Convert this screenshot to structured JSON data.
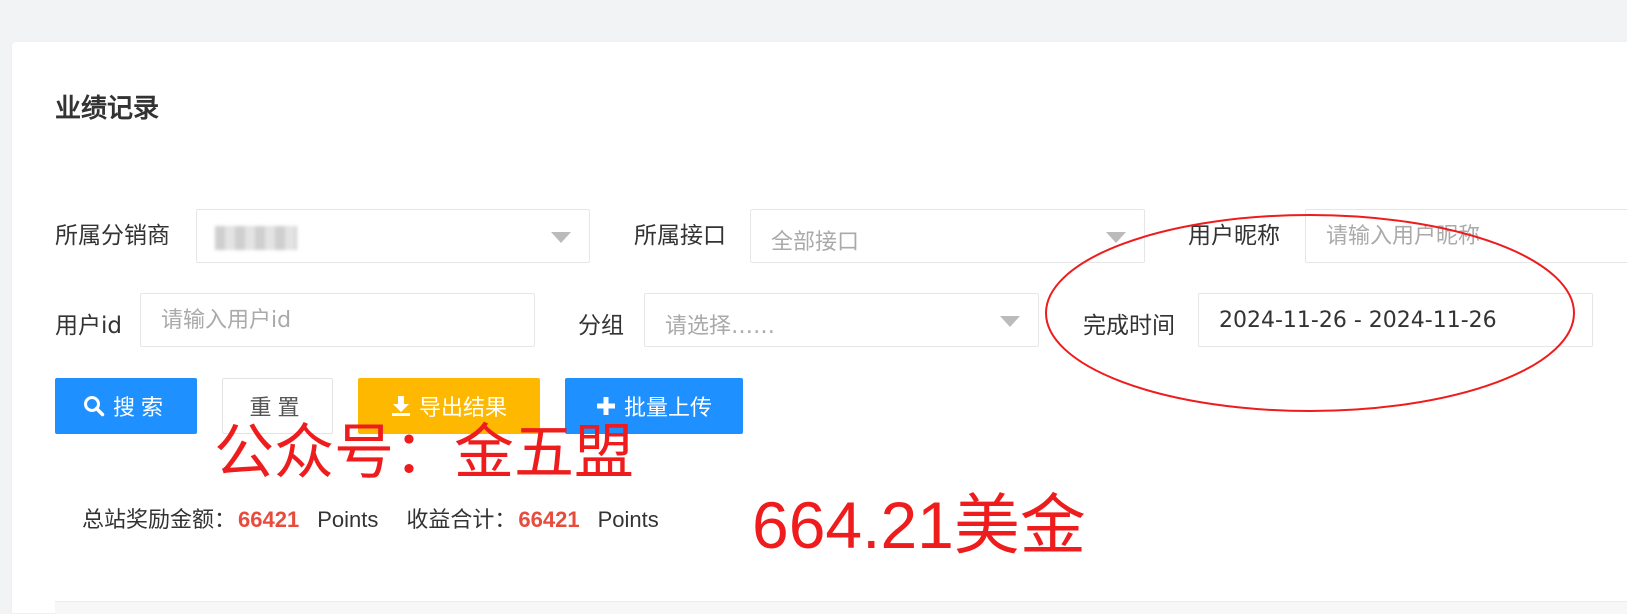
{
  "page": {
    "title": "业绩记录"
  },
  "filters": {
    "distributor": {
      "label": "所属分销商"
    },
    "interface": {
      "label": "所属接口",
      "value": "全部接口"
    },
    "nickname": {
      "label": "用户昵称",
      "placeholder": "请输入用户昵称"
    },
    "user_id": {
      "label": "用户id",
      "placeholder": "请输入用户id"
    },
    "group": {
      "label": "分组",
      "placeholder": "请选择……"
    },
    "finish_time": {
      "label": "完成时间",
      "value": "2024-11-26 - 2024-11-26"
    }
  },
  "buttons": {
    "search": "搜索",
    "reset": "重置",
    "export": "导出结果",
    "upload": "批量上传"
  },
  "stats": {
    "reward_label": "总站奖励金额：",
    "reward_value": "66421",
    "reward_unit": "Points",
    "income_label": "收益合计：",
    "income_value": "66421",
    "income_unit": "Points"
  },
  "annotations": {
    "watermark": "公众号：金五盟",
    "amount": "664.21美金"
  },
  "colors": {
    "primary": "#1e90ff",
    "warning": "#ffb800",
    "highlight_number": "#e74c3c",
    "annotation_red": "#ee1c1c"
  }
}
